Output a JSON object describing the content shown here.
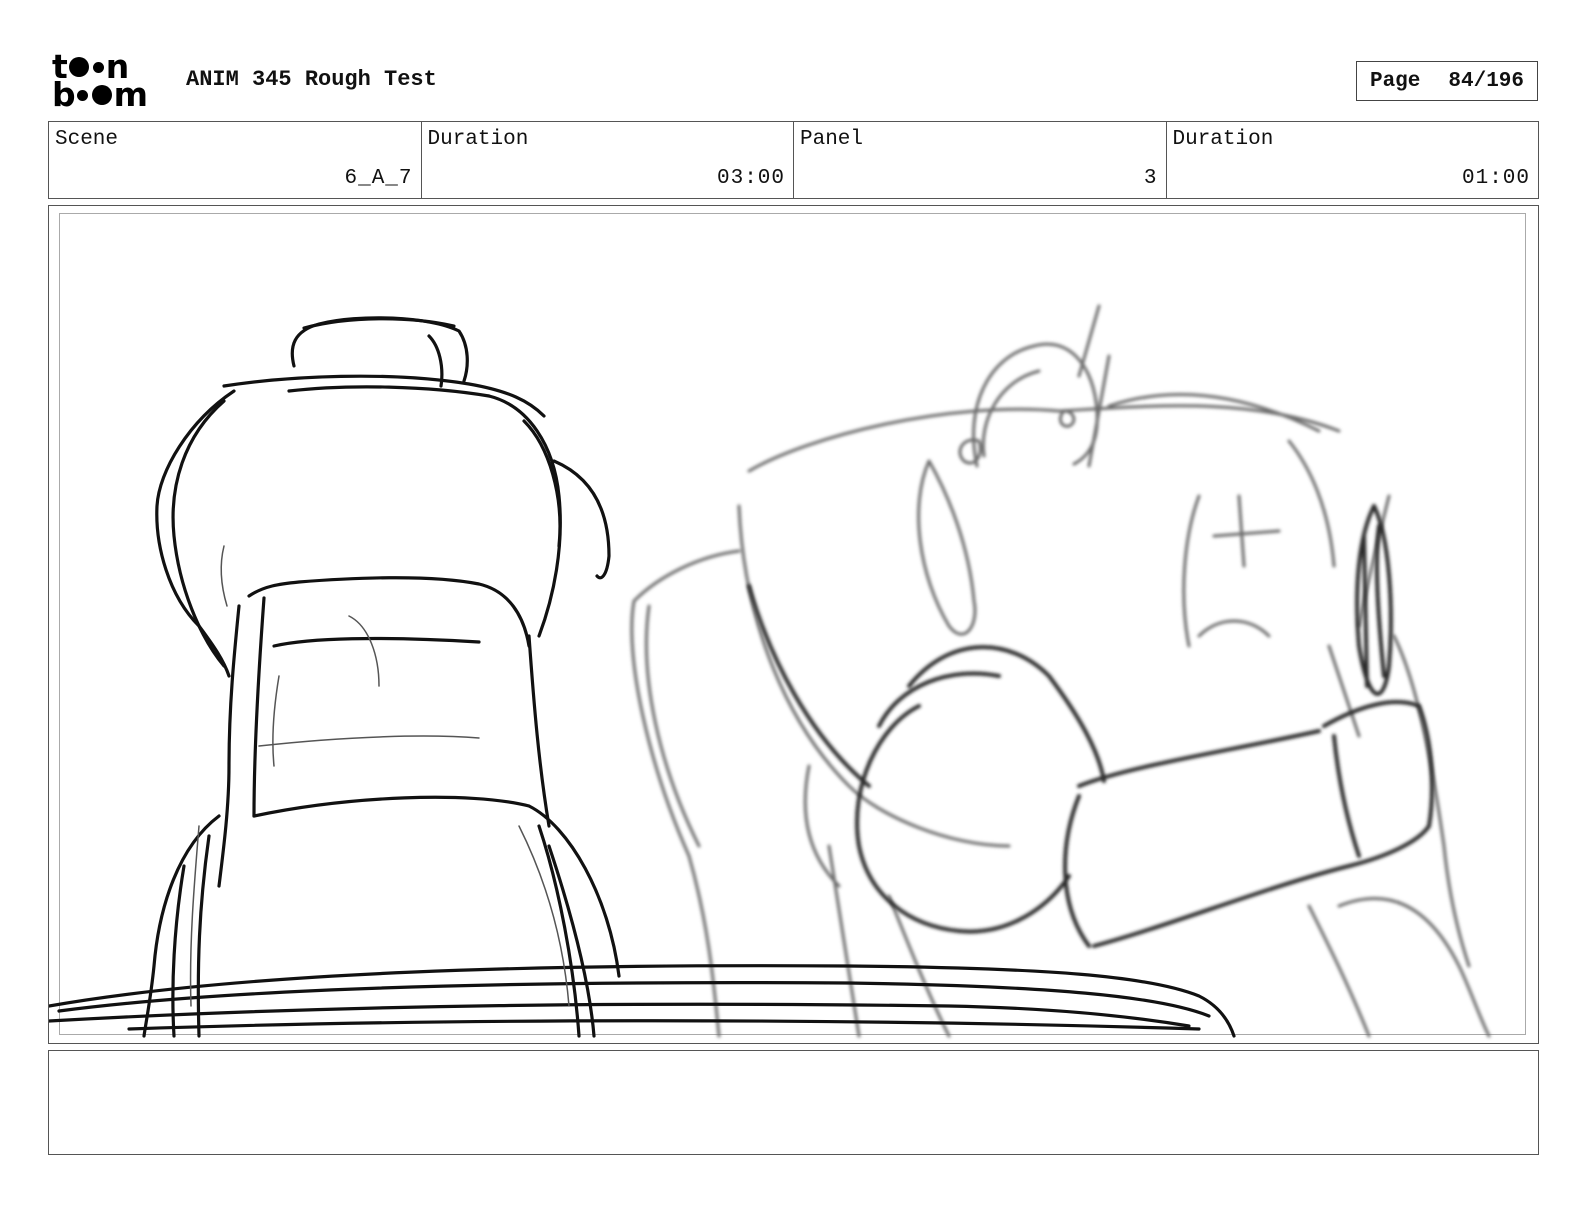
{
  "header": {
    "logo_text_top": "toon",
    "logo_text_bottom": "boom",
    "title": "ANIM 345 Rough Test",
    "page_label": "Page",
    "page_number": "84/196"
  },
  "info": {
    "scene_label": "Scene",
    "scene_value": "6_A_7",
    "scene_duration_label": "Duration",
    "scene_duration_value": "03:00",
    "panel_label": "Panel",
    "panel_value": "3",
    "panel_duration_label": "Duration",
    "panel_duration_value": "01:00"
  },
  "panel": {
    "drawing": "rough pencil storyboard sketch",
    "line_colors": {
      "foreground": "#111111",
      "background_figure": "#6a6a6a"
    }
  },
  "notes": {
    "text": ""
  }
}
